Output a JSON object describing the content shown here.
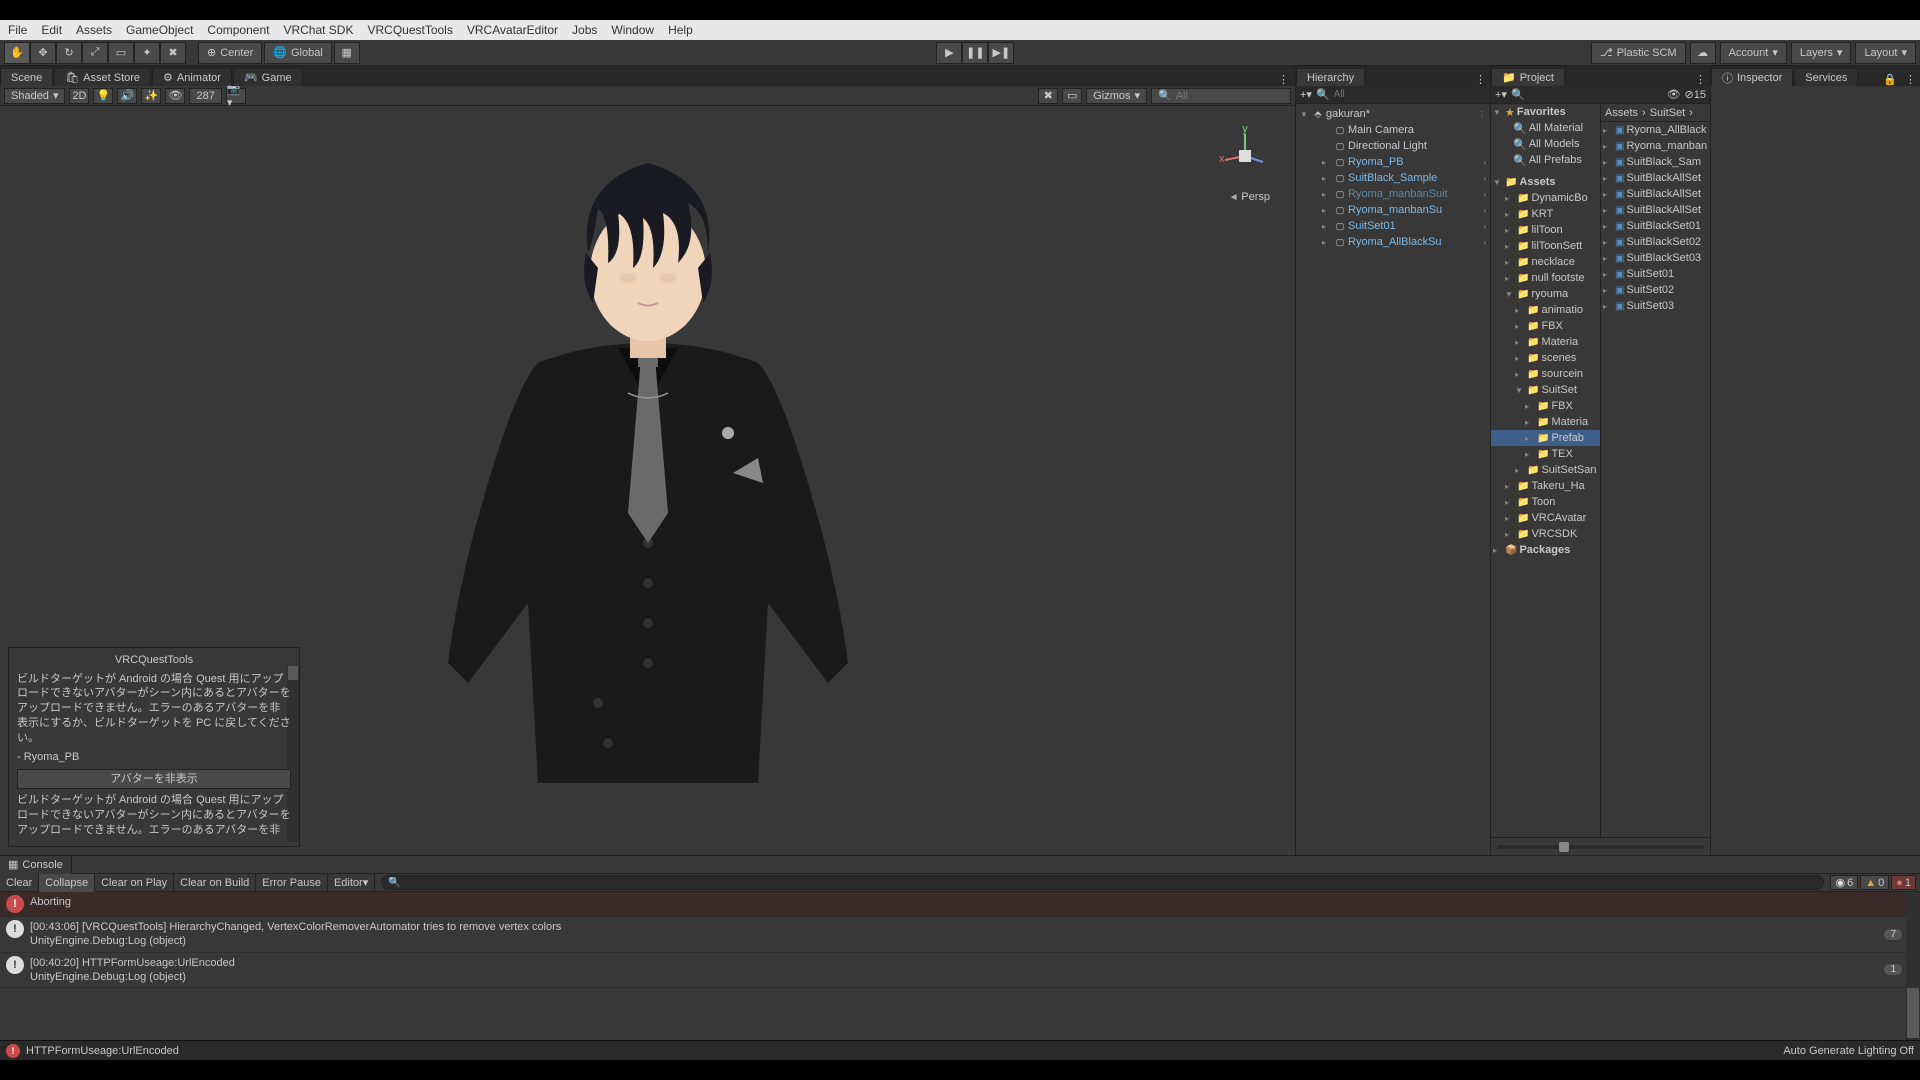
{
  "menubar": [
    "File",
    "Edit",
    "Assets",
    "GameObject",
    "Component",
    "VRChat SDK",
    "VRCQuestTools",
    "VRCAvatarEditor",
    "Jobs",
    "Window",
    "Help"
  ],
  "toolbar": {
    "center": "Center",
    "global": "Global",
    "plastic": "Plastic SCM",
    "account": "Account",
    "layers": "Layers",
    "layout": "Layout"
  },
  "tabs": {
    "scene": "Scene",
    "asset_store": "Asset Store",
    "animator": "Animator",
    "game": "Game"
  },
  "scene_toolbar": {
    "shading": "Shaded",
    "two_d": "2D",
    "gizmos": "Gizmos",
    "search_placeholder": "All",
    "vert_count": "287"
  },
  "scene_view": {
    "persp": "Persp",
    "axis_x": "x",
    "axis_y": "y"
  },
  "overlay": {
    "title": "VRCQuestTools",
    "body1": "ビルドターゲットが Android の場合 Quest 用にアップロードできないアバターがシーン内にあるとアバターをアップロードできません。エラーのあるアバターを非表示にするか、ビルドターゲットを PC に戻してください。",
    "item": "- Ryoma_PB",
    "button": "アバターを非表示",
    "body2": "ビルドターゲットが Android の場合 Quest 用にアップロードできないアバターがシーン内にあるとアバターをアップロードできません。エラーのあるアバターを非"
  },
  "hierarchy": {
    "title": "Hierarchy",
    "search_placeholder": "All",
    "root": "gakuran*",
    "items": [
      {
        "label": "Main Camera",
        "blue": false,
        "arrow": false,
        "indent": 1
      },
      {
        "label": "Directional Light",
        "blue": false,
        "arrow": false,
        "indent": 1
      },
      {
        "label": "Ryoma_PB",
        "blue": true,
        "arrow": true,
        "indent": 1
      },
      {
        "label": "SuitBlack_Sample",
        "blue": true,
        "arrow": true,
        "indent": 1
      },
      {
        "label": "Ryoma_manbanSuit",
        "blue": true,
        "arrow": true,
        "indent": 1,
        "dim": true
      },
      {
        "label": "Ryoma_manbanSu",
        "blue": true,
        "arrow": true,
        "indent": 1
      },
      {
        "label": "SuitSet01",
        "blue": true,
        "arrow": true,
        "indent": 1
      },
      {
        "label": "Ryoma_AllBlackSu",
        "blue": true,
        "arrow": true,
        "indent": 1
      }
    ]
  },
  "project": {
    "title": "Project",
    "favorites": "Favorites",
    "fav_items": [
      "All Material",
      "All Models",
      "All Prefabs"
    ],
    "assets": "Assets",
    "folders": [
      {
        "label": "DynamicBo",
        "indent": 1,
        "exp": false
      },
      {
        "label": "KRT",
        "indent": 1,
        "exp": false
      },
      {
        "label": "lilToon",
        "indent": 1,
        "exp": false
      },
      {
        "label": "lilToonSett",
        "indent": 1,
        "exp": false
      },
      {
        "label": "necklace",
        "indent": 1,
        "exp": false
      },
      {
        "label": "null footste",
        "indent": 1,
        "exp": false
      },
      {
        "label": "ryouma",
        "indent": 1,
        "exp": true
      },
      {
        "label": "animatio",
        "indent": 2,
        "exp": false
      },
      {
        "label": "FBX",
        "indent": 2,
        "exp": false
      },
      {
        "label": "Materia",
        "indent": 2,
        "exp": false
      },
      {
        "label": "scenes",
        "indent": 2,
        "exp": false
      },
      {
        "label": "sourcein",
        "indent": 2,
        "exp": false
      },
      {
        "label": "SuitSet",
        "indent": 2,
        "exp": true
      },
      {
        "label": "FBX",
        "indent": 3,
        "exp": false
      },
      {
        "label": "Materia",
        "indent": 3,
        "exp": false
      },
      {
        "label": "Prefab",
        "indent": 3,
        "exp": false,
        "selected": true
      },
      {
        "label": "TEX",
        "indent": 3,
        "exp": false
      },
      {
        "label": "SuitSetSan",
        "indent": 2,
        "exp": false
      },
      {
        "label": "Takeru_Ha",
        "indent": 1,
        "exp": false
      },
      {
        "label": "Toon",
        "indent": 1,
        "exp": false
      },
      {
        "label": "VRCAvatar",
        "indent": 1,
        "exp": false
      },
      {
        "label": "VRCSDK",
        "indent": 1,
        "exp": false
      }
    ],
    "packages": "Packages",
    "breadcrumb": [
      "Assets",
      "SuitSet"
    ],
    "list": [
      "Ryoma_AllBlack",
      "Ryoma_manban",
      "SuitBlack_Sam",
      "SuitBlackAllSet",
      "SuitBlackAllSet",
      "SuitBlackAllSet",
      "SuitBlackSet01",
      "SuitBlackSet02",
      "SuitBlackSet03",
      "SuitSet01",
      "SuitSet02",
      "SuitSet03"
    ],
    "hidden_count": "15"
  },
  "inspector": {
    "title": "Inspector",
    "services": "Services"
  },
  "console": {
    "title": "Console",
    "clear": "Clear",
    "collapse": "Collapse",
    "clear_play": "Clear on Play",
    "clear_build": "Clear on Build",
    "error_pause": "Error Pause",
    "editor": "Editor",
    "counts": {
      "info": "6",
      "warn": "0",
      "error": "1"
    },
    "logs": [
      {
        "type": "error",
        "line1": "Aborting",
        "count": ""
      },
      {
        "type": "info",
        "line1": "[00:43:06] [VRCQuestTools] HierarchyChanged, VertexColorRemoverAutomator tries to remove vertex colors",
        "line2": "UnityEngine.Debug:Log (object)",
        "count": "7"
      },
      {
        "type": "info",
        "line1": "[00:40:20] HTTPFormUseage:UrlEncoded",
        "line2": "UnityEngine.Debug:Log (object)",
        "count": "1"
      }
    ]
  },
  "statusbar": {
    "message": "HTTPFormUseage:UrlEncoded",
    "right": "Auto Generate Lighting Off"
  }
}
